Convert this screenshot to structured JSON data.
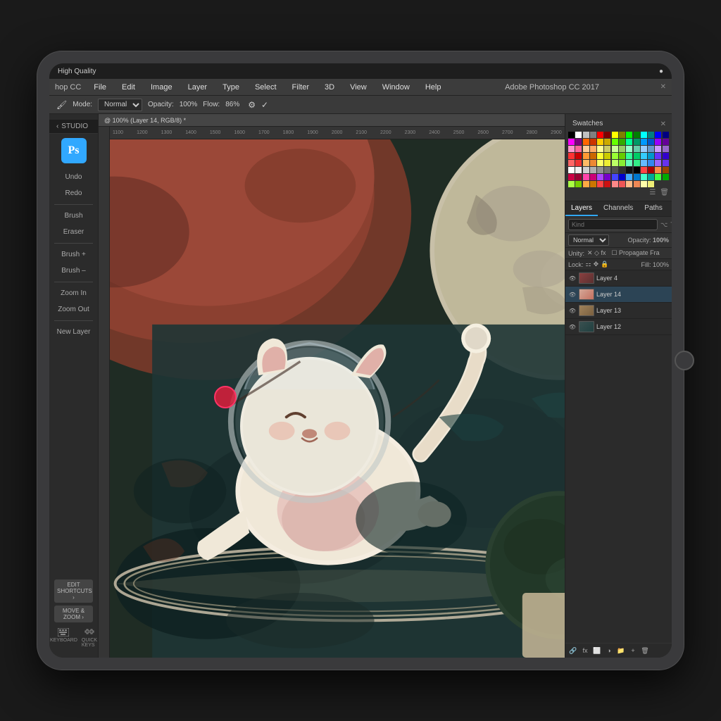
{
  "ipad": {
    "status_bar": {
      "wifi": "High Quality",
      "right_icon": "●"
    }
  },
  "menu_bar": {
    "app_name": "hop CC",
    "title": "Adobe Photoshop CC 2017",
    "close_btn": "✕",
    "items": [
      {
        "label": "File"
      },
      {
        "label": "Edit"
      },
      {
        "label": "Image"
      },
      {
        "label": "Layer"
      },
      {
        "label": "Type"
      },
      {
        "label": "Select"
      },
      {
        "label": "Filter"
      },
      {
        "label": "3D"
      },
      {
        "label": "View"
      },
      {
        "label": "Window"
      },
      {
        "label": "Help"
      }
    ]
  },
  "options_bar": {
    "mode_label": "Mode:",
    "mode_value": "Normal",
    "opacity_label": "Opacity:",
    "opacity_value": "100%",
    "flow_label": "Flow:",
    "flow_value": "86%"
  },
  "document_tab": {
    "label": "@ 100% (Layer 14, RGB/8) *"
  },
  "left_sidebar": {
    "studio_label": "‹ STUDIO",
    "ps_logo": "Ps",
    "tools": [
      {
        "label": "Undo"
      },
      {
        "label": "Redo"
      },
      {
        "label": "Brush"
      },
      {
        "label": "Eraser"
      },
      {
        "label": "Brush +"
      },
      {
        "label": "Brush –"
      },
      {
        "label": "Zoom In"
      },
      {
        "label": "Zoom Out"
      },
      {
        "label": "New Layer"
      }
    ],
    "edit_shortcuts": "EDIT SHORTCUTS ›",
    "move_zoom": "MOVE & ZOOM ›",
    "keyboard_label": "KEYBOARD",
    "quick_keys_label": "QUICK KEYS"
  },
  "swatches_panel": {
    "title": "Swatches",
    "colors": [
      "#000000",
      "#ffffff",
      "#c0c0c0",
      "#808080",
      "#ff0000",
      "#800000",
      "#ffff00",
      "#808000",
      "#00ff00",
      "#008000",
      "#00ffff",
      "#008080",
      "#0000ff",
      "#000080",
      "#ff00ff",
      "#800080",
      "#ff6600",
      "#cc3300",
      "#ffcc00",
      "#ccaa00",
      "#66ff00",
      "#33aa00",
      "#00ff99",
      "#009966",
      "#0099ff",
      "#0055cc",
      "#9900ff",
      "#660099",
      "#ff99cc",
      "#ff6699",
      "#ffcc99",
      "#ffaa66",
      "#ffff99",
      "#cccc66",
      "#ccff99",
      "#99cc66",
      "#99ffcc",
      "#66ccaa",
      "#99ccff",
      "#6699cc",
      "#cc99ff",
      "#9966cc",
      "#ff3333",
      "#cc0000",
      "#ff9933",
      "#cc6600",
      "#ffff33",
      "#cccc00",
      "#99ff33",
      "#66cc00",
      "#33ff99",
      "#00cc66",
      "#33ccff",
      "#0099cc",
      "#6633ff",
      "#3300cc",
      "#ff6666",
      "#ee3333",
      "#ffbb66",
      "#ee8833",
      "#ffff66",
      "#eeee33",
      "#bbff66",
      "#88ee33",
      "#66ffbb",
      "#33ee88",
      "#66bbff",
      "#3388ee",
      "#9966ff",
      "#6633ee",
      "#ffffff",
      "#f0f0f0",
      "#d0d0d0",
      "#b0b0b0",
      "#909090",
      "#707070",
      "#505050",
      "#303030",
      "#101010",
      "#000000",
      "#ff4444",
      "#aa0000",
      "#ff8844",
      "#994400",
      "#cc0044",
      "#990033",
      "#ff44aa",
      "#cc0077",
      "#aa44ff",
      "#7700cc",
      "#4444ff",
      "#0000cc",
      "#44aaff",
      "#0077cc",
      "#44ffcc",
      "#00aa99",
      "#44ff44",
      "#00aa00",
      "#aaff44",
      "#77cc00",
      "#ffaa44",
      "#cc7700",
      "#ff4444",
      "#cc1111",
      "#ff8888",
      "#ee5555",
      "#ffbb88",
      "#ee8855",
      "#ffffaa",
      "#eeee77"
    ]
  },
  "layers_panel": {
    "tabs": [
      {
        "label": "Layers",
        "active": true
      },
      {
        "label": "Channels"
      },
      {
        "label": "Paths"
      }
    ],
    "search_placeholder": "Kind",
    "blend_mode": "Normal",
    "opacity_label": "Opacity:",
    "opacity_value": "100%",
    "fill_label": "Fill:",
    "fill_value": "100%",
    "lock_label": "Lock:",
    "layers": [
      {
        "name": "Layer 4",
        "visible": true,
        "thumb_class": "thumb-l4"
      },
      {
        "name": "Layer 14",
        "visible": true,
        "thumb_class": "thumb-l14",
        "active": true
      },
      {
        "name": "Layer 13",
        "visible": true,
        "thumb_class": "thumb-l13"
      },
      {
        "name": "Layer 12",
        "visible": true,
        "thumb_class": "thumb-l12"
      }
    ]
  },
  "ruler": {
    "marks": [
      "1100",
      "1200",
      "1300",
      "1400",
      "1500",
      "1600",
      "1700",
      "1800",
      "1900",
      "2000",
      "2100",
      "2200",
      "2300",
      "2400",
      "2500",
      "2600",
      "2700",
      "2800",
      "2900"
    ]
  }
}
